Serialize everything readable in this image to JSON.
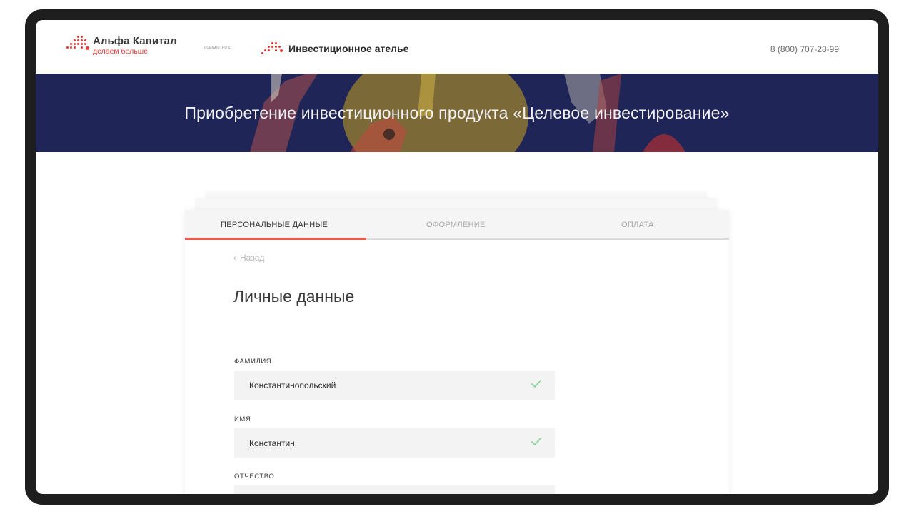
{
  "header": {
    "brand_name": "Альфа Капитал",
    "brand_tagline": "делаем больше",
    "together_text": "совместно с",
    "partner_name": "Инвестиционное ателье",
    "phone": "8 (800) 707-28-99"
  },
  "banner": {
    "title": "Приобретение инвестиционного продукта «Целевое инвестирование»"
  },
  "steps": [
    {
      "label": "ПЕРСОНАЛЬНЫЕ ДАННЫЕ",
      "active": true
    },
    {
      "label": "ОФОРМЛЕНИЕ",
      "active": false
    },
    {
      "label": "ОПЛАТА",
      "active": false
    }
  ],
  "form": {
    "back_label": "Назад",
    "title": "Личные данные",
    "fields": [
      {
        "label": "ФАМИЛИЯ",
        "value": "Константинопольский",
        "valid": true
      },
      {
        "label": "ИМЯ",
        "value": "Константин",
        "valid": true
      },
      {
        "label": "ОТЧЕСТВО",
        "value": "",
        "valid": false
      }
    ]
  },
  "colors": {
    "accent": "#ef5a4f",
    "banner": "#1f2557",
    "valid_check": "#8fd6a0"
  }
}
